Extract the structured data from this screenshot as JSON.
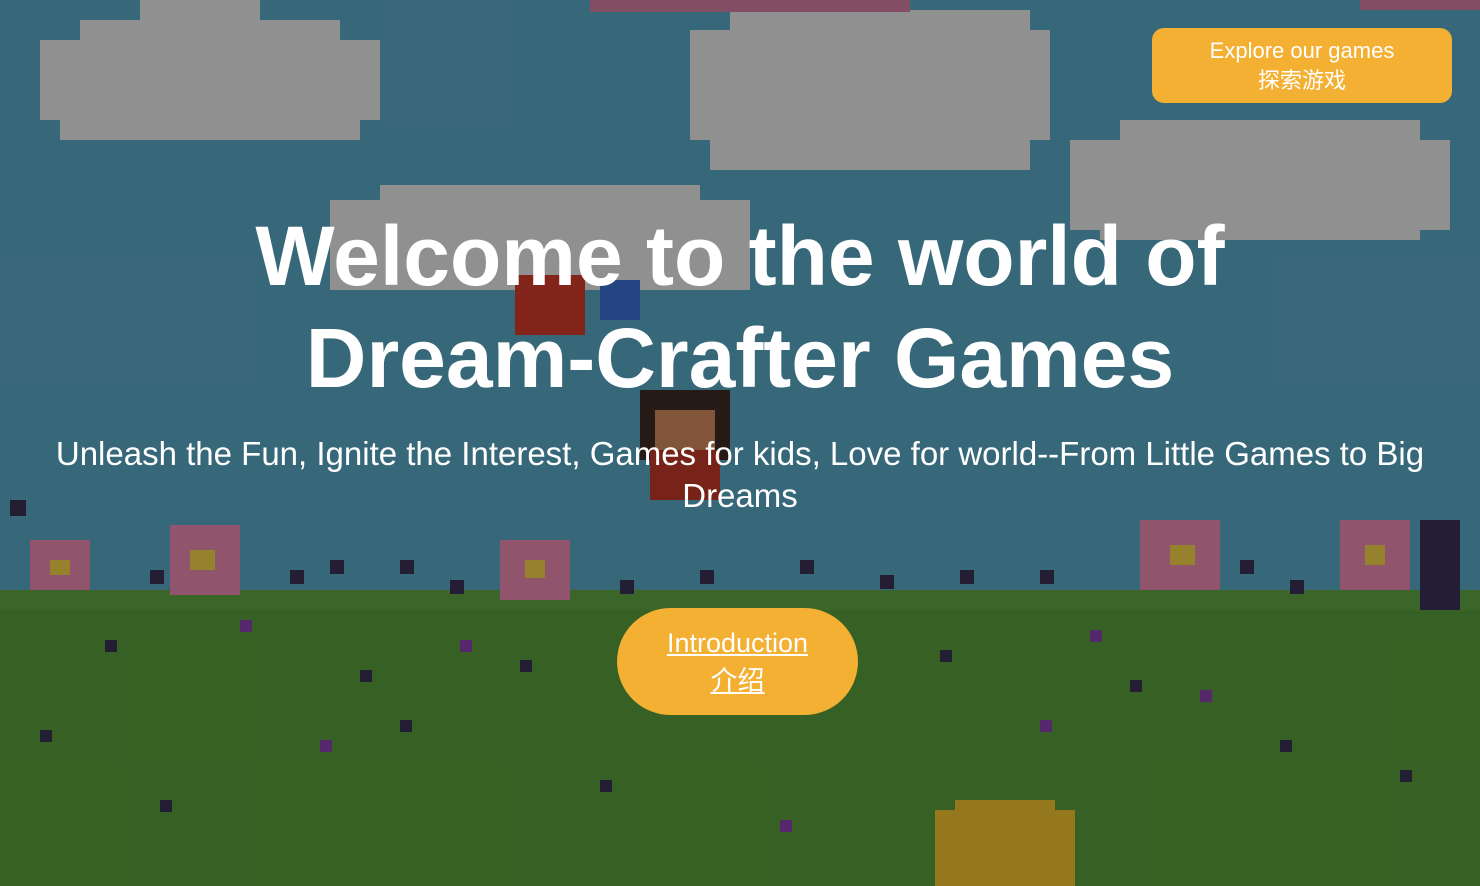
{
  "header": {
    "explore_button": {
      "label_en": "Explore our games",
      "label_zh": "探索游戏"
    }
  },
  "hero": {
    "headline": "Welcome to the world of Dream-Crafter Games",
    "tagline": "Unleash the Fun, Ignite the Interest, Games for kids, Love for world--From Little Games to Big Dreams",
    "intro_button": {
      "label_en": "Introduction",
      "label_zh": "介绍"
    }
  },
  "colors": {
    "accent": "#f3b033",
    "sky": "#5aa8c4",
    "grass": "#5a9c3a",
    "overlay": "rgba(0,0,0,0.38)"
  }
}
